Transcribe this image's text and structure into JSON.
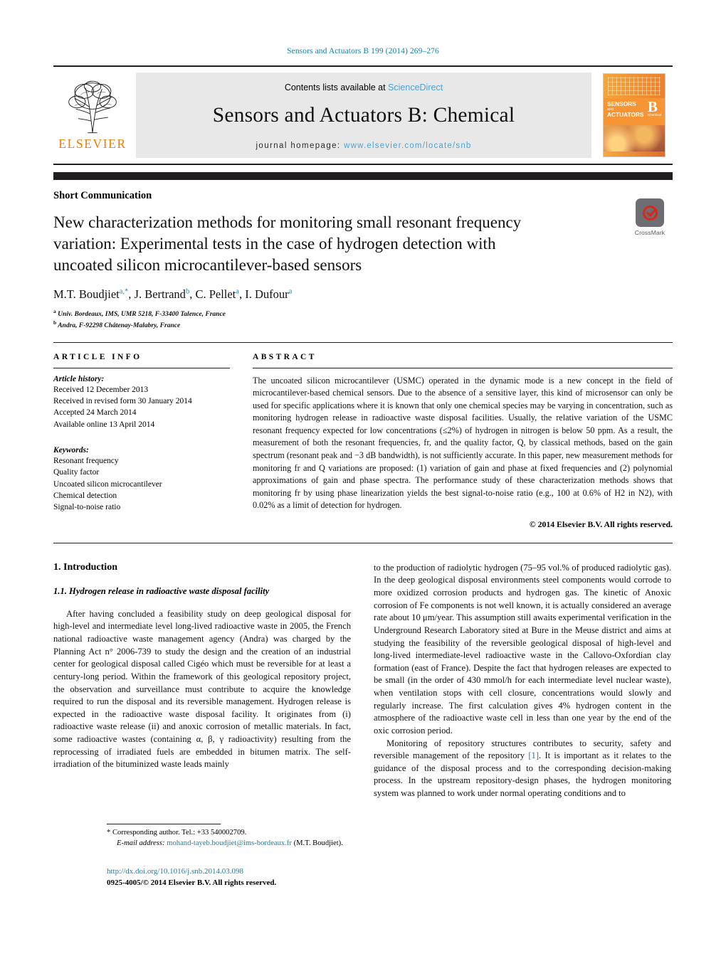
{
  "running_head": "Sensors and Actuators B 199 (2014) 269–276",
  "masthead": {
    "contents_prefix": "Contents lists available at ",
    "sciencedirect": "ScienceDirect",
    "journal_title": "Sensors and Actuators B: Chemical",
    "homepage_label": "journal homepage:",
    "homepage_url": "www.elsevier.com/locate/snb",
    "publisher": "ELSEVIER",
    "cover_title_line1": "SENSORS",
    "cover_title_line2": "ACTUATORS",
    "cover_and": "and",
    "cover_letter": "B",
    "cover_sub": "Chemical"
  },
  "article": {
    "type_label": "Short Communication",
    "title": "New characterization methods for monitoring small resonant frequency variation: Experimental tests in the case of hydrogen detection with uncoated silicon microcantilever-based sensors",
    "authors": [
      {
        "name": "M.T. Boudjiet",
        "sup": "a,*"
      },
      {
        "name": "J. Bertrand",
        "sup": "b"
      },
      {
        "name": "C. Pellet",
        "sup": "a"
      },
      {
        "name": "I. Dufour",
        "sup": "a"
      }
    ],
    "affiliations": [
      {
        "mark": "a",
        "text": "Univ. Bordeaux, IMS, UMR 5218, F-33400 Talence, France"
      },
      {
        "mark": "b",
        "text": "Andra, F-92298 Châtenay-Malabry, France"
      }
    ],
    "crossmark_label": "CrossMark"
  },
  "info": {
    "heading": "ARTICLE INFO",
    "history_title": "Article history:",
    "history": [
      "Received 12 December 2013",
      "Received in revised form 30 January 2014",
      "Accepted 24 March 2014",
      "Available online 13 April 2014"
    ],
    "keywords_title": "Keywords:",
    "keywords": [
      "Resonant frequency",
      "Quality factor",
      "Uncoated silicon microcantilever",
      "Chemical detection",
      "Signal-to-noise ratio"
    ]
  },
  "abstract": {
    "heading": "ABSTRACT",
    "text": "The uncoated silicon microcantilever (USMC) operated in the dynamic mode is a new concept in the field of microcantilever-based chemical sensors. Due to the absence of a sensitive layer, this kind of microsensor can only be used for specific applications where it is known that only one chemical species may be varying in concentration, such as monitoring hydrogen release in radioactive waste disposal facilities. Usually, the relative variation of the USMC resonant frequency expected for low concentrations (≤2%) of hydrogen in nitrogen is below 50 ppm. As a result, the measurement of both the resonant frequencies, fr, and the quality factor, Q, by classical methods, based on the gain spectrum (resonant peak and −3 dB bandwidth), is not sufficiently accurate. In this paper, new measurement methods for monitoring fr and Q variations are proposed: (1) variation of gain and phase at fixed frequencies and (2) polynomial approximations of gain and phase spectra. The performance study of these characterization methods shows that monitoring fr by using phase linearization yields the best signal-to-noise ratio (e.g., 100 at 0.6% of H2 in N2), with 0.02% as a limit of detection for hydrogen.",
    "copyright": "© 2014 Elsevier B.V. All rights reserved."
  },
  "body": {
    "section_number_title": "1. Introduction",
    "subsection_title": "1.1. Hydrogen release in radioactive waste disposal facility",
    "left_paragraph": "After having concluded a feasibility study on deep geological disposal for high-level and intermediate level long-lived radioactive waste in 2005, the French national radioactive waste management agency (Andra) was charged by the Planning Act n° 2006-739 to study the design and the creation of an industrial center for geological disposal called Cigéo which must be reversible for at least a century-long period. Within the framework of this geological repository project, the observation and surveillance must contribute to acquire the knowledge required to run the disposal and its reversible management. Hydrogen release is expected in the radioactive waste disposal facility. It originates from (i) radioactive waste release (ii) and anoxic corrosion of metallic materials. In fact, some radioactive wastes (containing α, β, γ radioactivity) resulting from the reprocessing of irradiated fuels are embedded in bitumen matrix. The self-irradiation of the bituminized waste leads mainly",
    "right_paragraph_1": "to the production of radiolytic hydrogen (75–95 vol.% of produced radiolytic gas). In the deep geological disposal environments steel components would corrode to more oxidized corrosion products and hydrogen gas. The kinetic of Anoxic corrosion of Fe components is not well known, it is actually considered an average rate about 10 μm/year. This assumption still awaits experimental verification in the Underground Research Laboratory sited at Bure in the Meuse district and aims at studying the feasibility of the reversible geological disposal of high-level and long-lived intermediate-level radioactive waste in the Callovo-Oxfordian clay formation (east of France). Despite the fact that hydrogen releases are expected to be small (in the order of 430 mmol/h for each intermediate level nuclear waste), when ventilation stops with cell closure, concentrations would slowly and regularly increase. The first calculation gives 4% hydrogen content in the atmosphere of the radioactive waste cell in less than one year by the end of the oxic corrosion period.",
    "right_paragraph_2_a": "Monitoring of repository structures contributes to security, safety and reversible management of the repository ",
    "right_paragraph_2_ref": "[1]",
    "right_paragraph_2_b": ". It is important as it relates to the guidance of the disposal process and to the corresponding decision-making process. In the upstream repository-design phases, the hydrogen monitoring system was planned to work under normal operating conditions and to"
  },
  "footer": {
    "corresponding_marker": "*",
    "corresponding_text": "Corresponding author. Tel.: +33 540002709.",
    "email_label": "E-mail address:",
    "email": "mohand-tayeb.boudjiet@ims-bordeaux.fr",
    "email_suffix": "(M.T. Boudjiet).",
    "doi_url": "http://dx.doi.org/10.1016/j.snb.2014.03.098",
    "issn_line": "0925-4005/© 2014 Elsevier B.V. All rights reserved."
  },
  "colors": {
    "link": "#1a7fa8",
    "sciencedirect": "#4ba3d3",
    "elsevier_orange": "#ef7d00",
    "crossmark_red": "#e2231a",
    "rule": "#231f20"
  }
}
